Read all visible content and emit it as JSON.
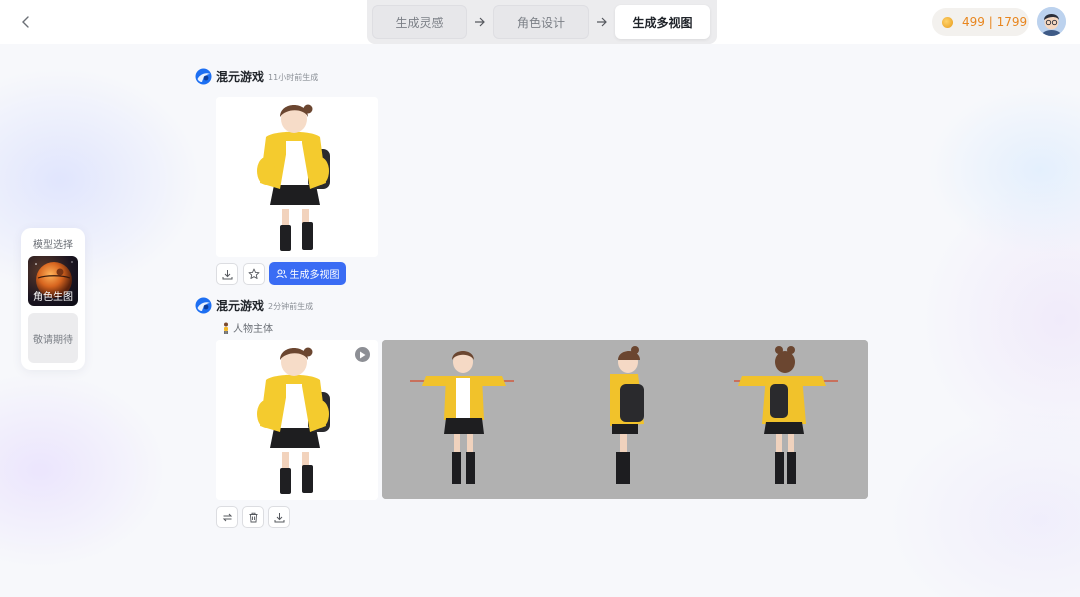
{
  "header": {
    "steps": [
      {
        "label": "生成灵感"
      },
      {
        "label": "角色设计"
      },
      {
        "label": "生成多视图"
      }
    ],
    "credits": "499 | 1799"
  },
  "model_panel": {
    "title": "模型选择",
    "selected": "角色生图",
    "coming_soon": "敬请期待"
  },
  "messages": [
    {
      "brand": "混元游戏",
      "time": "11小时前生成",
      "action": "生成多视图"
    },
    {
      "brand": "混元游戏",
      "time": "2分钟前生成",
      "subject": "人物主体"
    }
  ],
  "colors": {
    "accent": "#3a6cf4",
    "credit_text": "#e8861f"
  }
}
